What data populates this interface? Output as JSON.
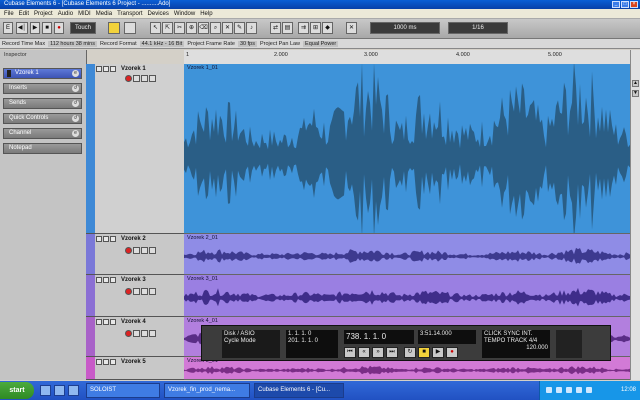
{
  "window": {
    "title": "Cubase Elements 6 - [Cubase Elements 6 Project - ..........Ado]"
  },
  "menu": [
    "File",
    "Edit",
    "Project",
    "Audio",
    "MIDI",
    "Media",
    "Transport",
    "Devices",
    "Window",
    "Help"
  ],
  "toolbar": {
    "buttons": [
      "E",
      "◀│",
      "▶",
      "■",
      "●",
      "Touch"
    ],
    "position_display": "1000 ms",
    "quantize_display": "1/16"
  },
  "infoline": {
    "items": [
      {
        "label": "Record Time Max",
        "value": "112 hours 38 mins"
      },
      {
        "label": "Record Format",
        "value": "44.1 kHz - 16 Bit"
      },
      {
        "label": "Project Frame Rate",
        "value": "30 fps"
      },
      {
        "label": "Project Pan Law",
        "value": "Equal Power"
      }
    ]
  },
  "left_panel": {
    "title": "Inspector",
    "items": [
      "Vzorek 1",
      "Inserts",
      "Sends",
      "Quick Controls",
      "Channel",
      "Notepad"
    ]
  },
  "ruler": {
    "marks": [
      "1",
      "2.000",
      "3.000",
      "4.000",
      "5.000"
    ]
  },
  "tracks": [
    {
      "name": "Vzorek 1",
      "event": "Vzorek 1_01",
      "color": "#2a7fc8",
      "strip": "#3e89d6"
    },
    {
      "name": "Vzorek 2",
      "event": "Vzorek 2_01",
      "color": "#7a6fc8",
      "strip": "#7a78d8"
    },
    {
      "name": "Vzorek 3",
      "event": "Vzorek 3_01",
      "color": "#7c5fc4",
      "strip": "#8b6fd4"
    },
    {
      "name": "Vzorek 4",
      "event": "Vzorek 4_01",
      "color": "#a05ac0",
      "strip": "#a862c8"
    },
    {
      "name": "Vzorek 5",
      "event": "Vzorek 5_01",
      "color": "#c050c0",
      "strip": "#c85ac8"
    }
  ],
  "transport": {
    "cpu_label": "Disk / ASIO",
    "mode_label": "Cycle Mode",
    "left_locator": "1. 1. 1. 0",
    "right_locator": "201. 1. 1. 0",
    "position": "738. 1. 1. 0",
    "time": "3:51.14.000",
    "click": "CLICK",
    "tempo_label": "TEMPO",
    "tempo": "120.000",
    "signature": "4/4",
    "track_label": "TRACK",
    "sync_label": "SYNC",
    "sync_value": "INT."
  },
  "taskbar": {
    "start": "start",
    "tasks": [
      "SOLOIST",
      "Vzorek_fin_prod_nema...",
      "Cubase Elements 6 - [Cu..."
    ],
    "clock": "12:08"
  }
}
